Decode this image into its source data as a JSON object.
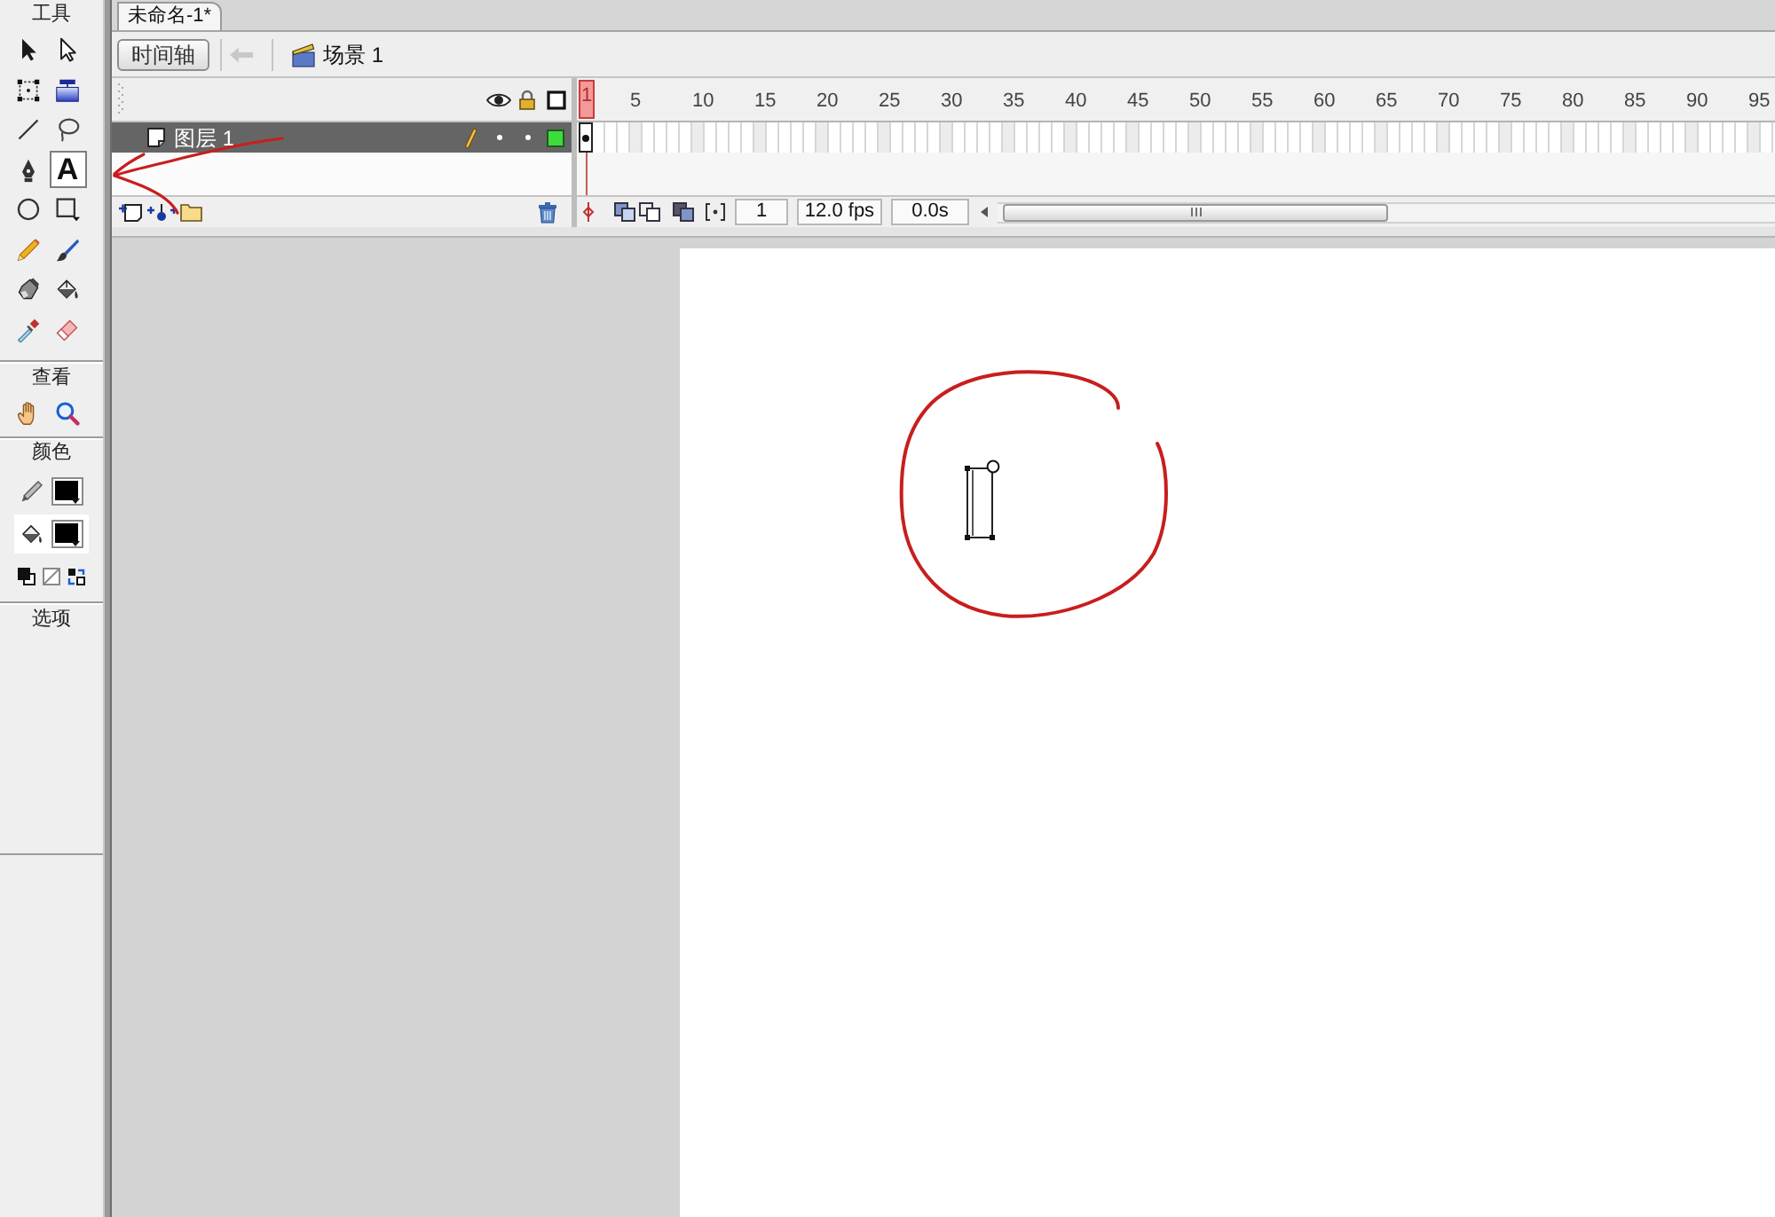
{
  "document_tabs": [
    {
      "label": "未命名-1*",
      "selected": true
    }
  ],
  "edit_bar": {
    "timeline_button": "时间轴",
    "scene": "场景 1"
  },
  "toolbox": {
    "sections": [
      {
        "title": "工具",
        "tools": [
          {
            "kind": "selection",
            "selected": false
          },
          {
            "kind": "subselection",
            "selected": false
          },
          {
            "kind": "free-transform",
            "selected": false
          },
          {
            "kind": "gradient-transform",
            "selected": false
          },
          {
            "kind": "line",
            "selected": false
          },
          {
            "kind": "lasso",
            "selected": false
          },
          {
            "kind": "pen",
            "selected": false
          },
          {
            "kind": "text",
            "glyph": "A",
            "selected": true
          },
          {
            "kind": "oval",
            "selected": false
          },
          {
            "kind": "rectangle",
            "selected": false
          },
          {
            "kind": "pencil",
            "selected": false
          },
          {
            "kind": "brush",
            "selected": false
          },
          {
            "kind": "ink-bottle",
            "selected": false
          },
          {
            "kind": "paint-bucket",
            "selected": false
          },
          {
            "kind": "eyedropper",
            "selected": false
          },
          {
            "kind": "eraser",
            "selected": false
          }
        ]
      },
      {
        "title": "查看",
        "tools": [
          {
            "kind": "hand",
            "selected": false
          },
          {
            "kind": "zoom",
            "selected": false
          }
        ]
      },
      {
        "title": "颜色",
        "swatches": [
          {
            "kind": "stroke",
            "color": "#000000",
            "selected": false
          },
          {
            "kind": "fill",
            "color": "#000000",
            "selected": true
          }
        ],
        "buttons": [
          {
            "kind": "default-colors"
          },
          {
            "kind": "no-color"
          },
          {
            "kind": "swap-colors"
          }
        ]
      },
      {
        "title": "选项"
      }
    ]
  },
  "timeline": {
    "layers": [
      {
        "name": "图层 1",
        "selected": true,
        "hidden": false,
        "locked": false,
        "color": "#3ddc3d",
        "frames": [
          {
            "kind": "keyframe"
          }
        ]
      }
    ],
    "frame_numbers": [
      "5",
      "10",
      "15",
      "20",
      "25",
      "30",
      "35",
      "40",
      "45",
      "50",
      "55",
      "60",
      "65",
      "70",
      "75",
      "80",
      "85",
      "90",
      "95"
    ],
    "playhead_frame": "1",
    "current_frame": "1",
    "frame_rate": "12.0 fps",
    "elapsed_time": "0.0s"
  }
}
